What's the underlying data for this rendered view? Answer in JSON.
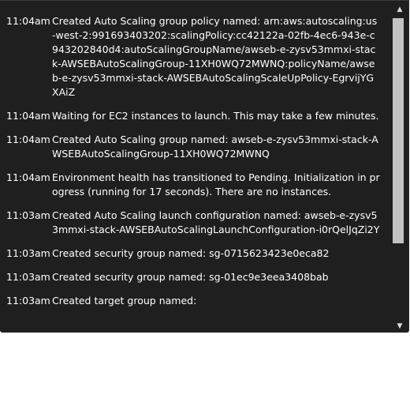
{
  "events": [
    {
      "time": "11:04am",
      "message": "Created Auto Scaling group policy named: arn:aws:autoscaling:us-west-2:991693403202:scalingPolicy:cc42122a-02fb-4ec6-943e-c943202840d4:autoScalingGroupName/awseb-e-zysv53mmxi-stack-AWSEBAutoScalingGroup-11XH0WQ72MWNQ:policyName/awseb-e-zysv53mmxi-stack-AWSEBAutoScalingScaleUpPolicy-EgrvijYGXAiZ"
    },
    {
      "time": "11:04am",
      "message": "Waiting for EC2 instances to launch. This may take a few minutes."
    },
    {
      "time": "11:04am",
      "message": "Created Auto Scaling group named: awseb-e-zysv53mmxi-stack-AWSEBAutoScalingGroup-11XH0WQ72MWNQ"
    },
    {
      "time": "11:04am",
      "message": "Environment health has transitioned to Pending. Initialization in progress (running for 17 seconds). There are no instances."
    },
    {
      "time": "11:03am",
      "message": "Created Auto Scaling launch configuration named: awseb-e-zysv53mmxi-stack-AWSEBAutoScalingLaunchConfiguration-i0rQelJqZi2Y"
    },
    {
      "time": "11:03am",
      "message": "Created security group named: sg-0715623423e0eca82"
    },
    {
      "time": "11:03am",
      "message": "Created security group named: sg-01ec9e3eea3408bab"
    },
    {
      "time": "11:03am",
      "message": "Created target group named:"
    }
  ],
  "scrollbar": {
    "up_icon": "triangle-up-icon",
    "down_icon": "triangle-down-icon",
    "colors": {
      "track": "#1f1f1f",
      "thumb": "#c2c2c2",
      "arrow": "#d9d9d9"
    }
  },
  "colors": {
    "background": "#1f1f1f",
    "text": "#ffffff",
    "page": "#ffffff"
  }
}
